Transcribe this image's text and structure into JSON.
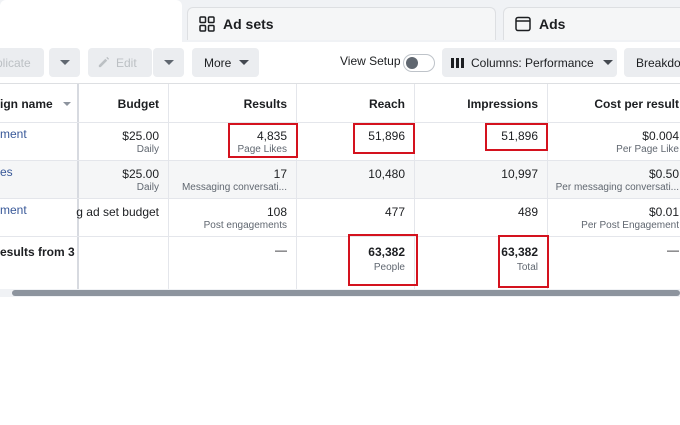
{
  "tabs": {
    "ad_sets_label": "Ad sets",
    "ads_label": "Ads",
    "ad_sets_icon": "grid-icon",
    "ads_icon": "window-icon"
  },
  "toolbar": {
    "duplicate_label": "plicate",
    "edit_label": "Edit",
    "more_label": "More",
    "view_setup_label": "View Setup",
    "view_setup_on": false,
    "columns_label": "Columns: Performance",
    "breakdown_label": "Breakdow"
  },
  "table": {
    "headers": {
      "name": "ign name",
      "budget": "Budget",
      "results": "Results",
      "reach": "Reach",
      "impressions": "Impressions",
      "cost_per_result": "Cost per result"
    },
    "rows": [
      {
        "name": "ment",
        "budget": "$25.00",
        "budget_sub": "Daily",
        "results": "4,835",
        "results_sub": "Page Likes",
        "reach": "51,896",
        "impressions": "51,896",
        "cost": "$0.004",
        "cost_sub": "Per Page Like"
      },
      {
        "name": "es",
        "budget": "$25.00",
        "budget_sub": "Daily",
        "results": "17",
        "results_sub": "Messaging conversati...",
        "reach": "10,480",
        "impressions": "10,997",
        "cost": "$0.50",
        "cost_sub": "Per messaging conversati..."
      },
      {
        "name": "ment",
        "budget": "g ad set budget",
        "results": "108",
        "results_sub": "Post engagements",
        "reach": "477",
        "impressions": "489",
        "cost": "$0.01",
        "cost_sub": "Per Post Engagement"
      }
    ],
    "total": {
      "name": "esults from 3",
      "results": "—",
      "reach": "63,382",
      "reach_sub": "People",
      "impressions": "63,382",
      "impressions_sub": "Total",
      "cost": "—"
    }
  },
  "highlight_color": "#d4121e"
}
